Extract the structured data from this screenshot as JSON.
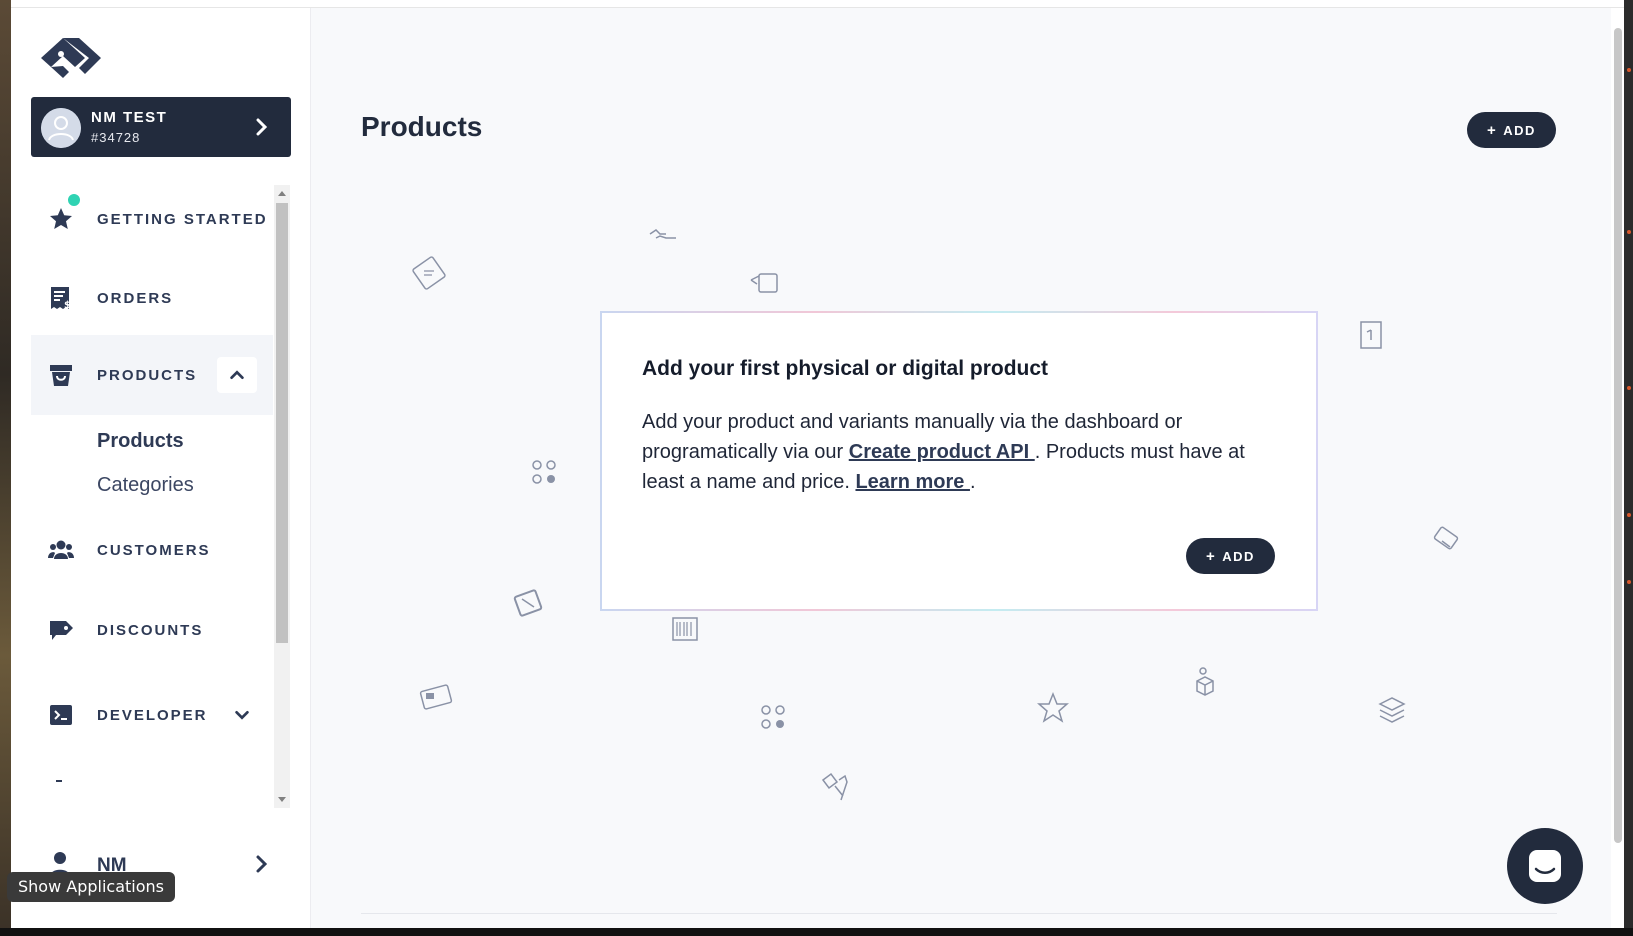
{
  "account": {
    "name": "NM TEST",
    "id": "#34728"
  },
  "nav": {
    "getting_started": "GETTING STARTED",
    "orders": "ORDERS",
    "products": "PRODUCTS",
    "products_sub": [
      "Products",
      "Categories"
    ],
    "customers": "CUSTOMERS",
    "discounts": "DISCOUNTS",
    "developer": "DEVELOPER"
  },
  "user": {
    "name": "NM"
  },
  "tooltip": "Show Applications",
  "main": {
    "title": "Products",
    "add_label": "ADD",
    "empty": {
      "heading": "Add your first physical or digital product",
      "text_1": "Add your product and variants manually via the dashboard or programatically via our ",
      "link_1": "Create product API ",
      "text_2": ". Products must have at least a name and price. ",
      "link_2": "Learn more ",
      "text_3": ".",
      "add_label": "ADD"
    }
  },
  "colors": {
    "brand_dark": "#222b3d",
    "accent_dot": "#2fd3b3",
    "page_bg": "#f8f9fb"
  }
}
